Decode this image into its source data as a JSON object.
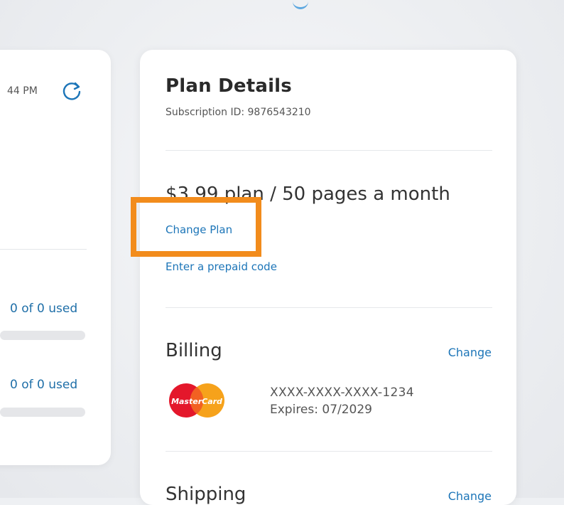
{
  "left_panel": {
    "time_fragment": "44 PM",
    "usage_1": "0 of 0 used",
    "usage_2": "0 of 0 used"
  },
  "plan_details": {
    "title": "Plan Details",
    "subscription_id": "Subscription ID: 9876543210",
    "plan_summary": "$3.99 plan / 50 pages a month",
    "change_plan_label": "Change Plan",
    "prepaid_label": "Enter a prepaid code"
  },
  "billing": {
    "title": "Billing",
    "change_label": "Change",
    "card_brand": "MasterCard",
    "card_number": "XXXX-XXXX-XXXX-1234",
    "card_expiry": "Expires: 07/2029"
  },
  "shipping": {
    "title": "Shipping",
    "change_label": "Change"
  },
  "colors": {
    "highlight": "#f28c1c",
    "link": "#1c75b8",
    "mastercard_red": "#e4172b",
    "mastercard_yellow": "#f6a21b"
  }
}
